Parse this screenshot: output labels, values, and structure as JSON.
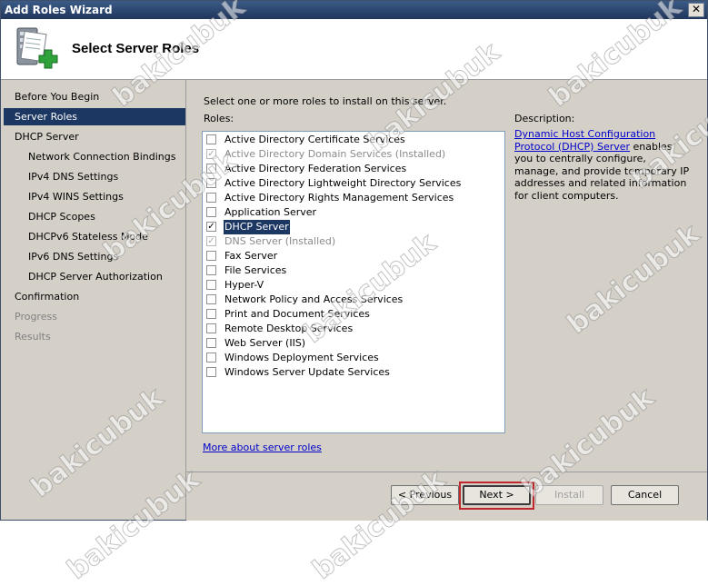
{
  "window": {
    "title": "Add Roles Wizard",
    "close_glyph": "✕"
  },
  "header": {
    "title": "Select Server Roles",
    "icon": "server-add-icon"
  },
  "nav": {
    "items": [
      {
        "label": "Before You Begin",
        "state": "normal",
        "level": 0
      },
      {
        "label": "Server Roles",
        "state": "selected",
        "level": 0
      },
      {
        "label": "DHCP Server",
        "state": "normal",
        "level": 0
      },
      {
        "label": "Network Connection Bindings",
        "state": "normal",
        "level": 1
      },
      {
        "label": "IPv4 DNS Settings",
        "state": "normal",
        "level": 1
      },
      {
        "label": "IPv4 WINS Settings",
        "state": "normal",
        "level": 1
      },
      {
        "label": "DHCP Scopes",
        "state": "normal",
        "level": 1
      },
      {
        "label": "DHCPv6 Stateless Mode",
        "state": "normal",
        "level": 1
      },
      {
        "label": "IPv6 DNS Settings",
        "state": "normal",
        "level": 1
      },
      {
        "label": "DHCP Server Authorization",
        "state": "normal",
        "level": 1
      },
      {
        "label": "Confirmation",
        "state": "normal",
        "level": 0
      },
      {
        "label": "Progress",
        "state": "disabled",
        "level": 0
      },
      {
        "label": "Results",
        "state": "disabled",
        "level": 0
      }
    ]
  },
  "main": {
    "instructions": "Select one or more roles to install on this server.",
    "roles_label": "Roles:",
    "roles": [
      {
        "label": "Active Directory Certificate Services",
        "checked": false,
        "disabled": false
      },
      {
        "label": "Active Directory Domain Services  (Installed)",
        "checked": true,
        "disabled": true
      },
      {
        "label": "Active Directory Federation Services",
        "checked": false,
        "disabled": false
      },
      {
        "label": "Active Directory Lightweight Directory Services",
        "checked": false,
        "disabled": false
      },
      {
        "label": "Active Directory Rights Management Services",
        "checked": false,
        "disabled": false
      },
      {
        "label": "Application Server",
        "checked": false,
        "disabled": false
      },
      {
        "label": "DHCP Server",
        "checked": true,
        "disabled": false,
        "highlighted": true
      },
      {
        "label": "DNS Server  (Installed)",
        "checked": true,
        "disabled": true
      },
      {
        "label": "Fax Server",
        "checked": false,
        "disabled": false
      },
      {
        "label": "File Services",
        "checked": false,
        "disabled": false
      },
      {
        "label": "Hyper-V",
        "checked": false,
        "disabled": false
      },
      {
        "label": "Network Policy and Access Services",
        "checked": false,
        "disabled": false
      },
      {
        "label": "Print and Document Services",
        "checked": false,
        "disabled": false
      },
      {
        "label": "Remote Desktop Services",
        "checked": false,
        "disabled": false
      },
      {
        "label": "Web Server (IIS)",
        "checked": false,
        "disabled": false
      },
      {
        "label": "Windows Deployment Services",
        "checked": false,
        "disabled": false
      },
      {
        "label": "Windows Server Update Services",
        "checked": false,
        "disabled": false
      }
    ],
    "description_label": "Description:",
    "description_link": "Dynamic Host Configuration Protocol (DHCP) Server",
    "description_text": " enables you to centrally configure, manage, and provide temporary IP addresses and related information for client computers.",
    "more_link": "More about server roles",
    "check_glyph": "✓"
  },
  "footer": {
    "previous": "< Previous",
    "next": "Next >",
    "install": "Install",
    "cancel": "Cancel"
  },
  "watermark": "bakicubuk",
  "colors": {
    "selection": "#1d3763",
    "highlight_border": "#c0272d",
    "link": "#0000cc"
  }
}
